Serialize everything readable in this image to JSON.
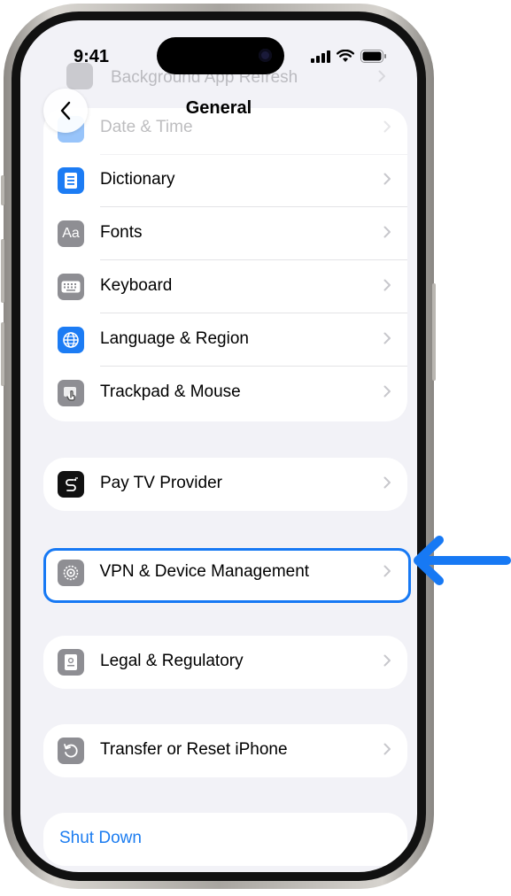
{
  "status_bar": {
    "time": "9:41"
  },
  "navbar": {
    "title": "General"
  },
  "background_rows": [
    "Background App Refresh",
    "Date & Time"
  ],
  "groups": {
    "language_group": [
      {
        "label": "Dictionary",
        "icon": "dictionary-icon",
        "color": "#1c7cf4"
      },
      {
        "label": "Fonts",
        "icon": "fonts-icon",
        "color": "#8e8e93"
      },
      {
        "label": "Keyboard",
        "icon": "keyboard-icon",
        "color": "#8e8e93"
      },
      {
        "label": "Language & Region",
        "icon": "globe-icon",
        "color": "#1c7cf4"
      },
      {
        "label": "Trackpad & Mouse",
        "icon": "trackpad-icon",
        "color": "#8e8e93"
      }
    ],
    "tv_group": [
      {
        "label": "Pay TV Provider",
        "icon": "tv-provider-icon",
        "color": "#111111"
      }
    ],
    "vpn_group": [
      {
        "label": "VPN & Device Management",
        "icon": "gear-icon",
        "color": "#8e8e93"
      }
    ],
    "legal_group": [
      {
        "label": "Legal & Regulatory",
        "icon": "legal-icon",
        "color": "#8e8e93"
      }
    ],
    "reset_group": [
      {
        "label": "Transfer or Reset iPhone",
        "icon": "reset-icon",
        "color": "#8e8e93"
      }
    ],
    "shutdown": {
      "label": "Shut Down",
      "color": "#1b7cf0"
    }
  },
  "highlight": {
    "color": "#1779f4",
    "target": "VPN & Device Management"
  }
}
